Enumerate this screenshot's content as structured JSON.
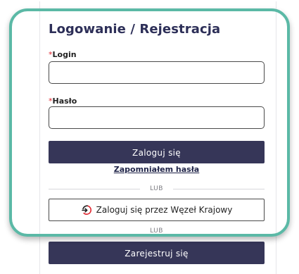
{
  "login_panel": {
    "title": "Logowanie / Rejestracja",
    "login_field": {
      "required_marker": "*",
      "label": "Login",
      "value": "",
      "placeholder": ""
    },
    "password_field": {
      "required_marker": "*",
      "label": "Hasło",
      "value": "",
      "placeholder": ""
    },
    "login_button_label": "Zaloguj się",
    "forgot_password_link": "Zapomniałem hasła",
    "divider_text": "LUB",
    "national_node_button_label": "Zaloguj się przez Węzeł Krajowy",
    "national_node_icon": "login-arrow-icon",
    "divider2_text": "LUB",
    "register_button_label": "Zarejestruj się"
  },
  "colors": {
    "primary": "#363658",
    "highlight": "#5bb9a6",
    "required": "#e0242d",
    "title": "#2d2f58"
  }
}
